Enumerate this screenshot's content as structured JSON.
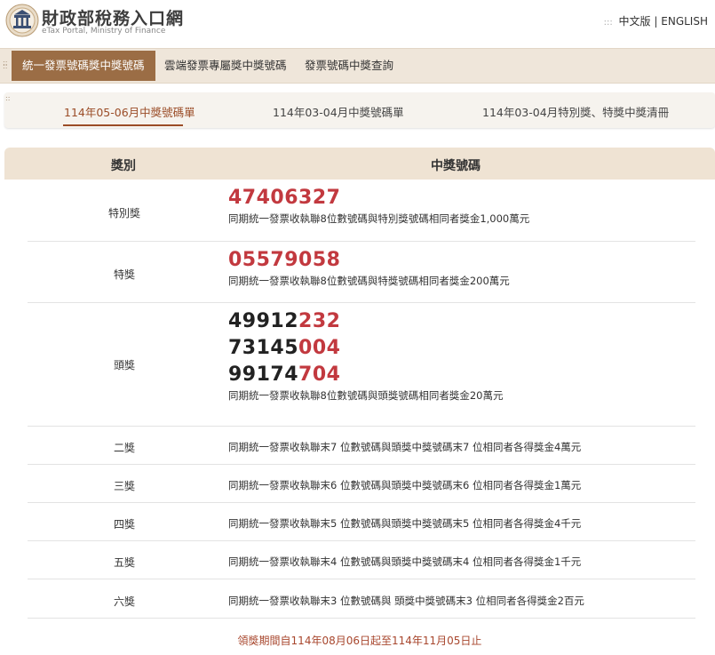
{
  "header": {
    "title": "財政部稅務入口網",
    "subtitle": "eTax Portal, Ministry of Finance",
    "lang_zh": "中文版",
    "lang_separator": "|",
    "lang_en": "ENGLISH"
  },
  "main_nav": [
    {
      "label": "統一發票號碼獎中獎號碼",
      "active": true
    },
    {
      "label": "雲端發票專屬獎中獎號碼",
      "active": false
    },
    {
      "label": "發票號碼中獎查詢",
      "active": false
    }
  ],
  "sub_nav": [
    {
      "label": "114年05-06月中獎號碼單",
      "active": true
    },
    {
      "label": "114年03-04月中獎號碼單",
      "active": false
    },
    {
      "label": "114年03-04月特別獎、特獎中獎清冊",
      "active": false
    }
  ],
  "table": {
    "col_category": "獎別",
    "col_numbers": "中獎號碼",
    "special_prize": {
      "category": "特別獎",
      "number": "47406327",
      "desc": "同期統一發票收執聯8位數號碼與特別獎號碼相同者獎金1,000萬元"
    },
    "grand_prize": {
      "category": "特獎",
      "number": "05579058",
      "desc": "同期統一發票收執聯8位數號碼與特獎號碼相同者獎金200萬元"
    },
    "first_prize": {
      "category": "頭獎",
      "numbers": [
        {
          "prefix": "49912",
          "suffix": "232"
        },
        {
          "prefix": "73145",
          "suffix": "004"
        },
        {
          "prefix": "99174",
          "suffix": "704"
        }
      ],
      "desc": "同期統一發票收執聯8位數號碼與頭獎號碼相同者獎金20萬元"
    },
    "other_prizes": [
      {
        "category": "二獎",
        "desc": "同期統一發票收執聯末7 位數號碼與頭獎中獎號碼末7 位相同者各得獎金4萬元"
      },
      {
        "category": "三獎",
        "desc": "同期統一發票收執聯末6 位數號碼與頭獎中獎號碼末6 位相同者各得獎金1萬元"
      },
      {
        "category": "四獎",
        "desc": "同期統一發票收執聯末5 位數號碼與頭獎中獎號碼末5 位相同者各得獎金4千元"
      },
      {
        "category": "五獎",
        "desc": "同期統一發票收執聯末4 位數號碼與頭獎中獎號碼末4 位相同者各得獎金1千元"
      },
      {
        "category": "六獎",
        "desc": "同期統一發票收執聯末3 位數號碼與 頭獎中獎號碼末3 位相同者各得獎金2百元"
      }
    ],
    "claim_period": "領獎期間自114年08月06日起至114年11月05日止"
  },
  "colors": {
    "accent_brown": "#9b6d45",
    "number_red": "#c2393f",
    "nav_bg": "#efe6da",
    "table_header_bg": "#efe3d3"
  }
}
